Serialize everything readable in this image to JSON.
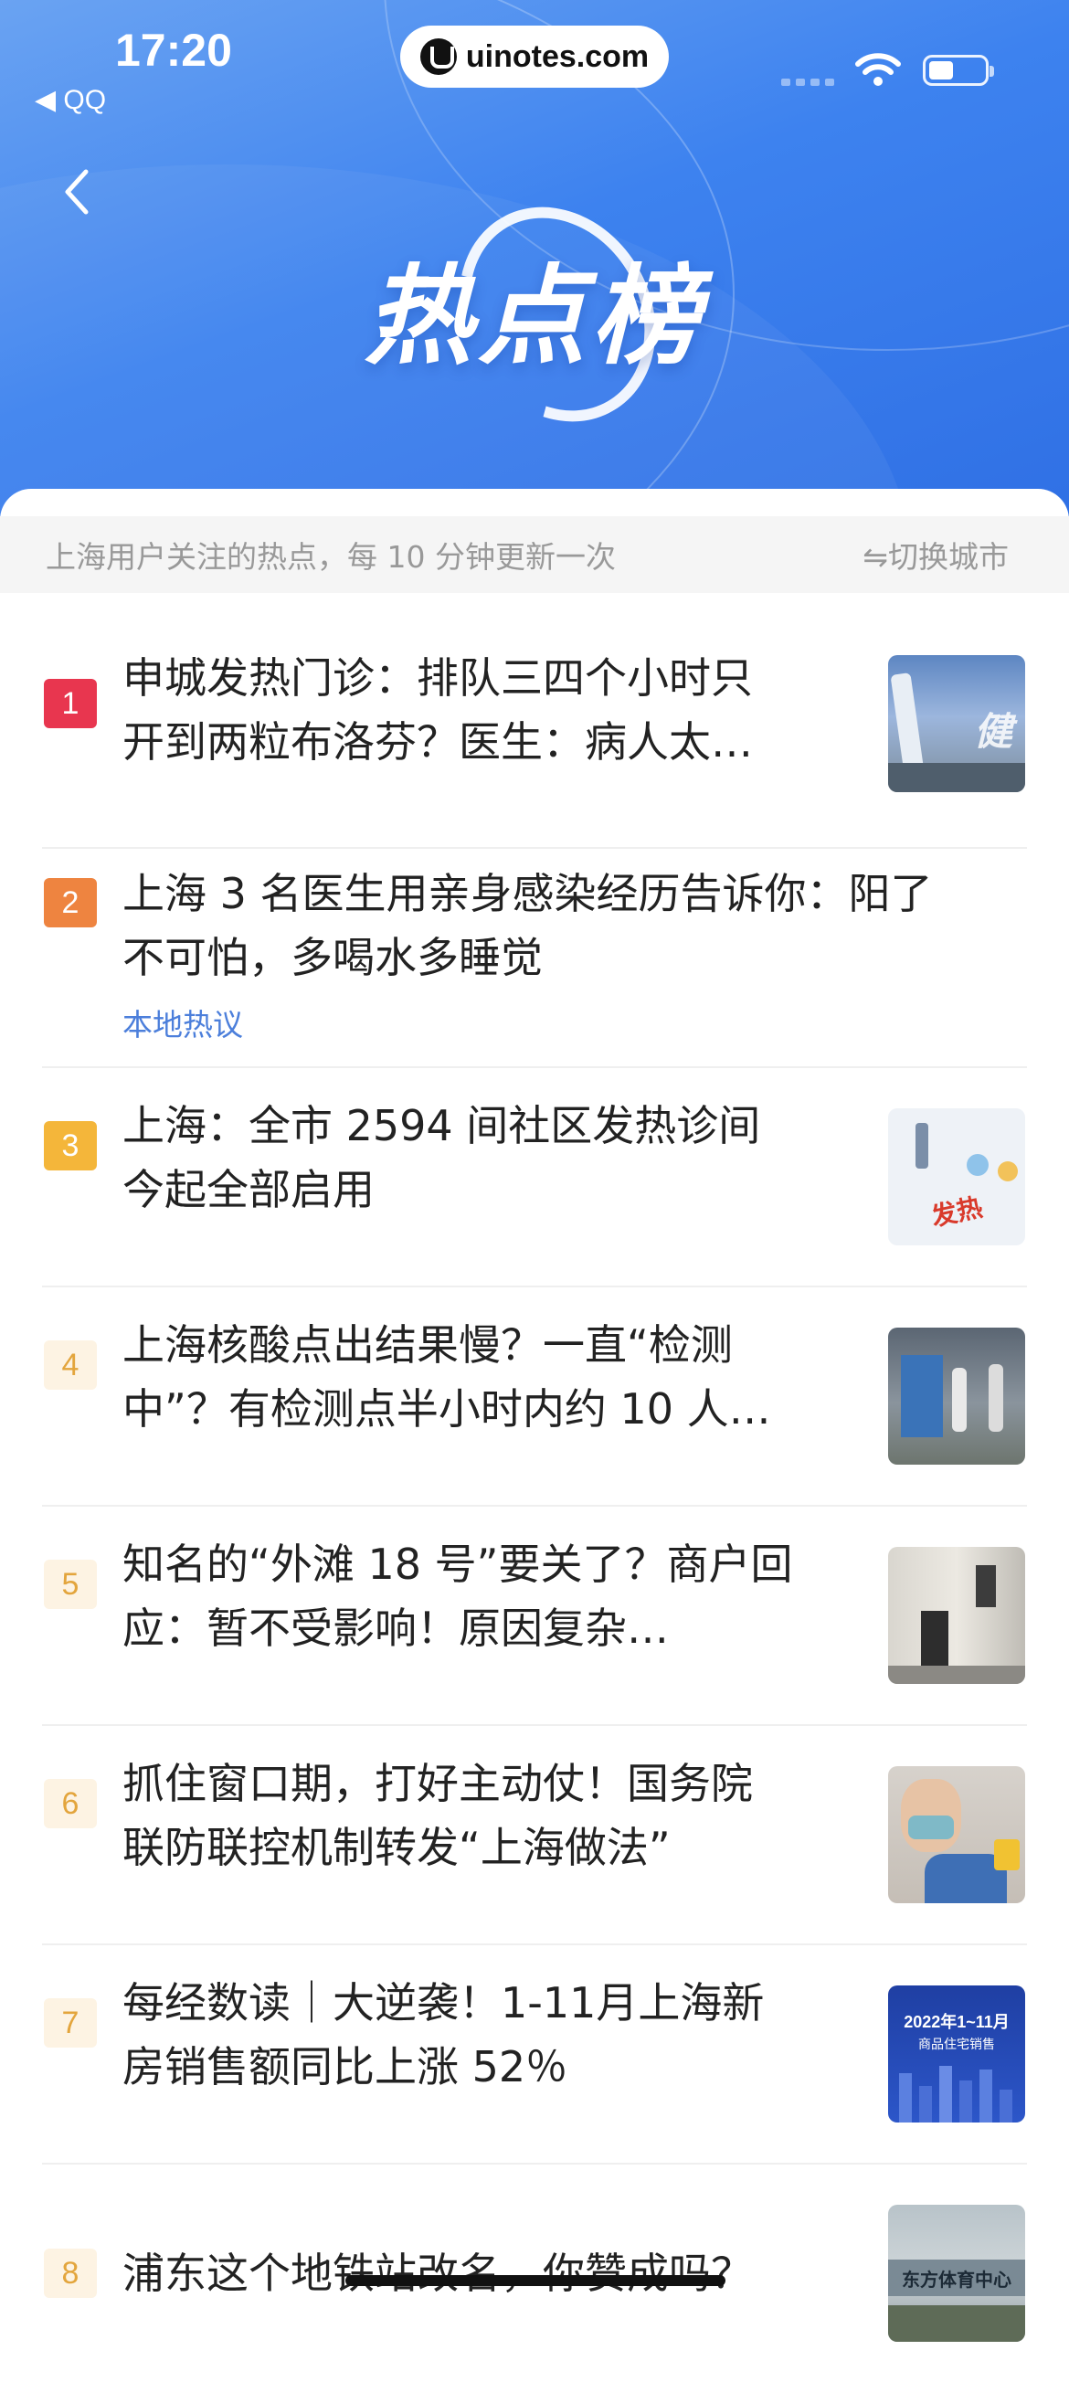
{
  "status_bar": {
    "time": "17:20",
    "back_app": "◀ QQ",
    "watermark": "uinotes.com"
  },
  "banner": {
    "title": "热点榜"
  },
  "notice": {
    "text": "上海用户关注的热点，每 10 分钟更新一次",
    "switch_city": "⇋切换城市"
  },
  "colors": {
    "rank1": "#e8364f",
    "rank2": "#ee8440",
    "rank3": "#f4b63a",
    "accent": "#4c7fdb"
  },
  "items": [
    {
      "rank": "1",
      "title_line1": "申城发热门诊：排队三四个小时只",
      "title_line2": "开到两粒布洛芬？医生：病人太…",
      "tag": "",
      "thumb": "jian-image",
      "thumb_text": "健"
    },
    {
      "rank": "2",
      "title_line1": "上海 3 名医生用亲身感染经历告诉你：阳了",
      "title_line2": "不可怕，多喝水多睡觉",
      "tag": "本地热议",
      "thumb": "",
      "thumb_text": ""
    },
    {
      "rank": "3",
      "title_line1": "上海：全市 2594 间社区发热诊间",
      "title_line2": "今起全部启用",
      "tag": "",
      "thumb": "fever-image",
      "thumb_text": "发热"
    },
    {
      "rank": "4",
      "title_line1": "上海核酸点出结果慢？一直“检测",
      "title_line2": "中”？有检测点半小时内约 10 人…",
      "tag": "",
      "thumb": "testing-booth-image",
      "thumb_text": ""
    },
    {
      "rank": "5",
      "title_line1": "知名的“外滩 18 号”要关了？商户回",
      "title_line2": "应：暂不受影响！原因复杂…",
      "tag": "",
      "thumb": "building-image",
      "thumb_text": ""
    },
    {
      "rank": "6",
      "title_line1": "抓住窗口期，打好主动仗！国务院",
      "title_line2": "联防联控机制转发“上海做法”",
      "tag": "",
      "thumb": "vaccination-image",
      "thumb_text": ""
    },
    {
      "rank": "7",
      "title_line1": "每经数读｜大逆袭！1-11月上海新",
      "title_line2": "房销售额同比上涨 52％",
      "tag": "",
      "thumb": "sales-chart-image",
      "thumb_text": "2022年1~11月",
      "thumb_subtext": "商品住宅销售"
    },
    {
      "rank": "8",
      "title_line1": "浦东这个地铁站改名，你赞成吗？",
      "title_line2": "",
      "tag": "",
      "thumb": "sports-center-image",
      "thumb_text": "东方体育中心"
    }
  ]
}
